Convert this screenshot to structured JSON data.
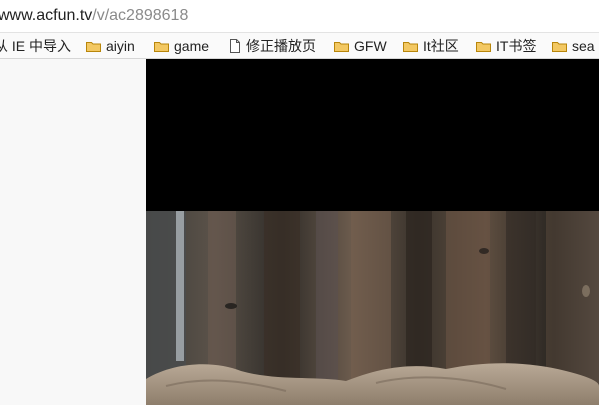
{
  "address_bar": {
    "url_host": "www.acfun.tv",
    "url_path": "/v/ac2898618"
  },
  "bookmarks": [
    {
      "label": "从 IE 中导入",
      "icon": "none"
    },
    {
      "label": "aiyin",
      "icon": "folder-icon"
    },
    {
      "label": "game",
      "icon": "folder-icon"
    },
    {
      "label": "修正播放页",
      "icon": "page-icon"
    },
    {
      "label": "GFW",
      "icon": "folder-icon"
    },
    {
      "label": "It社区",
      "icon": "folder-icon"
    },
    {
      "label": "IT书签",
      "icon": "folder-icon"
    },
    {
      "label": "sea",
      "icon": "folder-icon"
    }
  ],
  "colors": {
    "folder": "#e8b94a",
    "letterbox": "#000000",
    "sidebar": "#f8f8f8"
  }
}
